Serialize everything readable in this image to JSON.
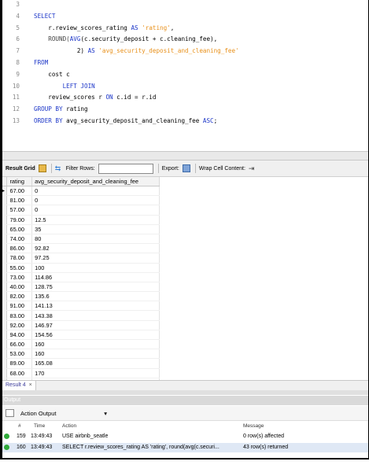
{
  "editor": {
    "lines": [
      {
        "n": "3",
        "parts": []
      },
      {
        "n": "4",
        "parts": [
          {
            "t": "SELECT",
            "c": "kw"
          }
        ]
      },
      {
        "n": "5",
        "parts": [
          {
            "t": "    r.review_scores_rating ",
            "c": ""
          },
          {
            "t": "AS",
            "c": "kw"
          },
          {
            "t": " 'rating'",
            "c": "str"
          },
          {
            "t": ",",
            "c": ""
          }
        ]
      },
      {
        "n": "6",
        "parts": [
          {
            "t": "    ROUND(",
            "c": "fn"
          },
          {
            "t": "AVG",
            "c": "kw"
          },
          {
            "t": "(c.security_deposit + c.cleaning_fee),",
            "c": ""
          }
        ]
      },
      {
        "n": "7",
        "parts": [
          {
            "t": "            2) ",
            "c": ""
          },
          {
            "t": "AS",
            "c": "kw"
          },
          {
            "t": " 'avg_security_deposit_and_cleaning_fee'",
            "c": "str"
          }
        ]
      },
      {
        "n": "8",
        "parts": [
          {
            "t": "FROM",
            "c": "kw"
          }
        ]
      },
      {
        "n": "9",
        "parts": [
          {
            "t": "    cost c",
            "c": ""
          }
        ]
      },
      {
        "n": "10",
        "parts": [
          {
            "t": "        ",
            "c": ""
          },
          {
            "t": "LEFT JOIN",
            "c": "kw"
          }
        ]
      },
      {
        "n": "11",
        "parts": [
          {
            "t": "    review_scores r ",
            "c": ""
          },
          {
            "t": "ON",
            "c": "kw"
          },
          {
            "t": " c.id = r.id",
            "c": ""
          }
        ]
      },
      {
        "n": "12",
        "parts": [
          {
            "t": "GROUP BY",
            "c": "kw"
          },
          {
            "t": " rating",
            "c": ""
          }
        ]
      },
      {
        "n": "13",
        "parts": [
          {
            "t": "ORDER BY",
            "c": "kw"
          },
          {
            "t": " avg_security_deposit_and_cleaning_fee ",
            "c": ""
          },
          {
            "t": "ASC",
            "c": "kw"
          },
          {
            "t": ";",
            "c": ""
          }
        ]
      }
    ]
  },
  "toolbar": {
    "result_grid": "Result Grid",
    "filter_rows": "Filter Rows:",
    "export": "Export:",
    "wrap": "Wrap Cell Content:"
  },
  "grid": {
    "headers": [
      "rating",
      "avg_security_deposit_and_cleaning_fee"
    ],
    "rows": [
      [
        "67.00",
        "0"
      ],
      [
        "81.00",
        "0"
      ],
      [
        "57.00",
        "0"
      ],
      [
        "79.00",
        "12.5"
      ],
      [
        "65.00",
        "35"
      ],
      [
        "74.00",
        "80"
      ],
      [
        "86.00",
        "92.82"
      ],
      [
        "78.00",
        "97.25"
      ],
      [
        "55.00",
        "100"
      ],
      [
        "73.00",
        "114.86"
      ],
      [
        "40.00",
        "128.75"
      ],
      [
        "82.00",
        "135.6"
      ],
      [
        "91.00",
        "141.13"
      ],
      [
        "83.00",
        "143.38"
      ],
      [
        "92.00",
        "146.97"
      ],
      [
        "94.00",
        "154.56"
      ],
      [
        "66.00",
        "160"
      ],
      [
        "53.00",
        "160"
      ],
      [
        "89.00",
        "165.08"
      ],
      [
        "68.00",
        "170"
      ],
      [
        "77.00",
        "172.5"
      ]
    ]
  },
  "result_tab": "Result 4",
  "result_tab_close": "×",
  "output": {
    "header": "Output",
    "selector": "Action Output",
    "columns": [
      "#",
      "Time",
      "Action",
      "Message"
    ],
    "rows": [
      {
        "num": "159",
        "time": "13:49:43",
        "action": "USE airbnb_seatle",
        "message": "0 row(s) affected"
      },
      {
        "num": "160",
        "time": "13:49:43",
        "action": "SELECT    r.review_scores_rating AS 'rating', round(avg(c.securi...",
        "message": "43 row(s) returned"
      }
    ]
  }
}
